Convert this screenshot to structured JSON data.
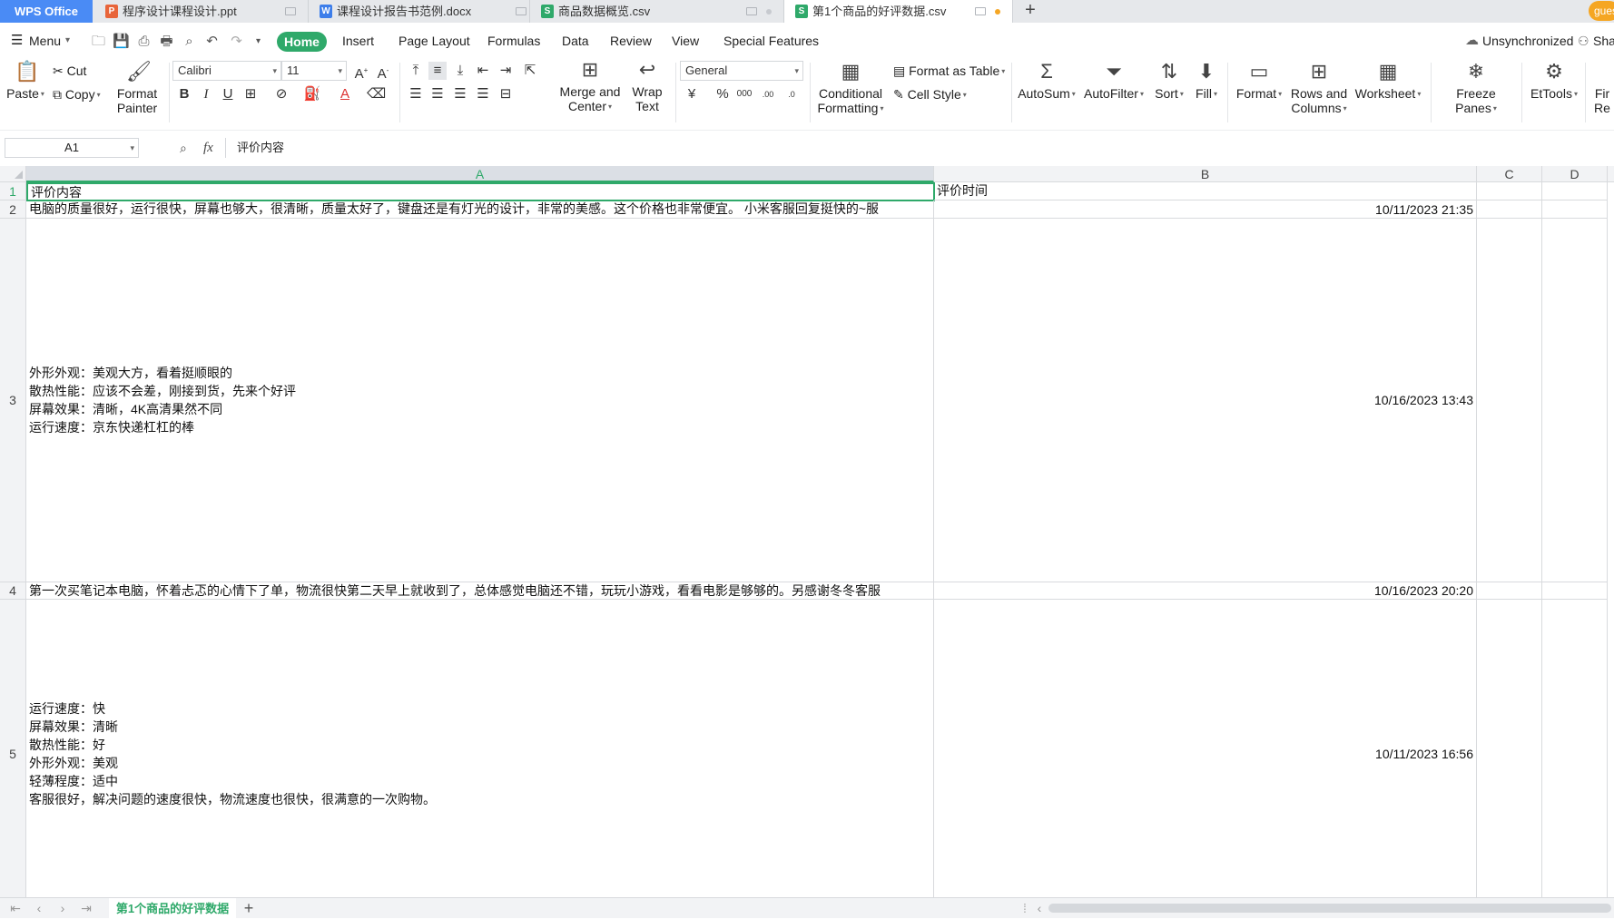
{
  "app": {
    "logo": "WPS Office"
  },
  "tabs": [
    {
      "label": "程序设计课程设计.ppt",
      "icon": "P",
      "icon_color": "#e8653a"
    },
    {
      "label": "课程设计报告书范例.docx",
      "icon": "W",
      "icon_color": "#3d7eea"
    },
    {
      "label": "商品数据概览.csv",
      "icon": "S",
      "icon_color": "#2fa96a"
    },
    {
      "label": "第1个商品的好评数据.csv",
      "icon": "S",
      "icon_color": "#2fa96a"
    }
  ],
  "user": {
    "avatar_text": "gues"
  },
  "menu": {
    "menu_label": "Menu",
    "items": [
      "Home",
      "Insert",
      "Page Layout",
      "Formulas",
      "Data",
      "Review",
      "View",
      "Special Features"
    ],
    "sync_status": "Unsynchronized",
    "share_label": "Sha"
  },
  "ribbon": {
    "paste": "Paste",
    "cut": "Cut",
    "copy": "Copy",
    "format_painter": [
      "Format",
      "Painter"
    ],
    "font_name": "Calibri",
    "font_size": "11",
    "merge_center": [
      "Merge and",
      "Center"
    ],
    "wrap_text": [
      "Wrap",
      "Text"
    ],
    "number_format": "General",
    "conditional_formatting": [
      "Conditional",
      "Formatting"
    ],
    "format_as_table": "Format as Table",
    "cell_style": "Cell Style",
    "autosum": "AutoSum",
    "autofilter": "AutoFilter",
    "sort": "Sort",
    "fill": "Fill",
    "format": "Format",
    "rows_columns": [
      "Rows and",
      "Columns"
    ],
    "worksheet": "Worksheet",
    "freeze_panes": "Freeze Panes",
    "ettools": "EtTools",
    "find_replace": [
      "Fir",
      "Re"
    ]
  },
  "formula_bar": {
    "name_box": "A1",
    "fx": "fx",
    "content": "评价内容"
  },
  "grid": {
    "columns": [
      "A",
      "B",
      "C",
      "D"
    ],
    "rows": [
      {
        "num": "1",
        "a": "评价内容",
        "b": "评价时间"
      },
      {
        "num": "2",
        "a": "电脑的质量很好，运行很快，屏幕也够大，很清晰，质量太好了，键盘还是有灯光的设计，非常的美感。这个价格也非常便宜。 小米客服回复挺快的~服",
        "b": "10/11/2023 21:35"
      },
      {
        "num": "3",
        "a": "外形外观：美观大方，看着挺顺眼的\n散热性能：应该不会差，刚接到货，先来个好评\n屏幕效果：清晰，4K高清果然不同\n运行速度：京东快递杠杠的棒",
        "b": "10/16/2023 13:43"
      },
      {
        "num": "4",
        "a": "第一次买笔记本电脑，怀着忐忑的心情下了单，物流很快第二天早上就收到了，总体感觉电脑还不错，玩玩小游戏，看看电影是够够的。另感谢冬冬客服",
        "b": "10/16/2023 20:20"
      },
      {
        "num": "5",
        "a": "运行速度：快\n屏幕效果：清晰\n散热性能：好\n外形外观：美观\n轻薄程度：适中\n客服很好，解决问题的速度很快，物流速度也很快，很满意的一次购物。",
        "b": "10/11/2023 16:56"
      }
    ]
  },
  "sheets": {
    "active": "第1个商品的好评数据"
  }
}
